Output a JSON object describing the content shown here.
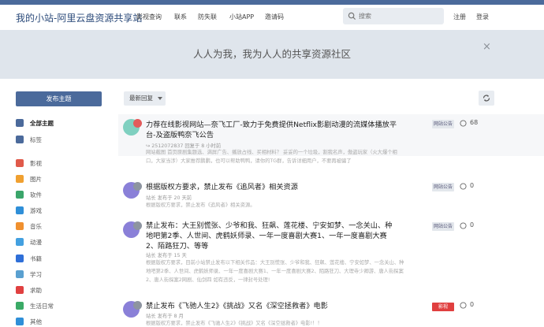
{
  "header": {
    "site_title": "我的小站-阿里云盘资源共享站",
    "nav": [
      {
        "label": "影视查询"
      },
      {
        "label": "联系"
      },
      {
        "label": "防失联"
      },
      {
        "label": "小站APP"
      },
      {
        "label": "邀请码"
      }
    ],
    "search_placeholder": "搜索",
    "register": "注册",
    "login": "登录"
  },
  "banner": {
    "text": "人人为我，我为人人的共享资源社区",
    "close": "×"
  },
  "sidebar": {
    "new_topic": "发布主题",
    "items": [
      {
        "label": "全部主题",
        "color": "#4b6a9b",
        "icon": "chat-icon"
      },
      {
        "label": "标签",
        "color": "#4b6a9b",
        "icon": "grid-icon"
      },
      {
        "label": "影视",
        "color": "#e05a4a",
        "icon": "film-icon"
      },
      {
        "label": "图片",
        "color": "#f0a030",
        "icon": "image-icon"
      },
      {
        "label": "软件",
        "color": "#3aa56a",
        "icon": "software-icon"
      },
      {
        "label": "游戏",
        "color": "#2f8fd8",
        "icon": "game-icon"
      },
      {
        "label": "音乐",
        "color": "#f0902f",
        "icon": "music-icon"
      },
      {
        "label": "动漫",
        "color": "#43a0e0",
        "icon": "anime-icon"
      },
      {
        "label": "书籍",
        "color": "#2f6fd8",
        "icon": "book-icon"
      },
      {
        "label": "学习",
        "color": "#5aa0d0",
        "icon": "study-icon"
      },
      {
        "label": "求助",
        "color": "#e04040",
        "icon": "help-icon"
      },
      {
        "label": "生活日常",
        "color": "#3aaa66",
        "icon": "life-icon"
      },
      {
        "label": "其他",
        "color": "#2f8fd8",
        "icon": "other-icon"
      }
    ]
  },
  "toolbar": {
    "sort_label": "最新回复"
  },
  "topics": [
    {
      "title": "力荐在线影视网站—奈飞工厂-致力于免费提供Netflix影剧动漫的流媒体播放平台-及盗版鸭奈飞公告",
      "meta": "↪ 2512072837 回复于 8 小时前",
      "excerpt": "网站截图 首页原剧集题选、满屏广告、播放占线、买相材料？ 妥妥的一个垃圾，割我名声，傲盗玩家（火大爆个相口，大家当涉）大家推荐鹏鹏，也可以帮助鸭鸭，请你的TG群，告诉详细用户，不要再被骗了",
      "category": "网站公告",
      "replies": "68",
      "avatar_color": "#7fd0c0"
    },
    {
      "title": "根据版权方要求，禁止发布《追风者》相关资源",
      "meta": "站长 发布于 20 天前",
      "excerpt": "根据版权方要求，禁止发布《追风者》相关资源。",
      "category": "网站公告",
      "replies": "0",
      "avatar_color": "#8a80d8"
    },
    {
      "title": "禁止发布：大王别慌张、少爷和我、狂飙、莲花楼、宁安如梦、一念关山、种地吧第2季、人世间、虎鹤妖师录、一年一度喜剧大赛1、一年一度喜剧大赛2、陌路狂刀、等等",
      "meta": "站长 发布于 15 天",
      "excerpt": "根据版权方要求，目前小站禁止发布以下相关作品：大王别慌张、少爷和我、狂飙、莲花楼、宁安如梦、一念关山、种地吧第2季、人世间、虎鹤妖师录、一年一度喜剧大赛1、一年一度喜剧大赛2、陌路狂刀、大理寺少卿游、唐人街探案2、唐人街探案2网剧、仙剑四 如有违反，一律封号处理!",
      "category": "网站公告",
      "replies": "0",
      "avatar_color": "#8a80d8"
    },
    {
      "title": "禁止发布《飞驰人生2》《挑战》又名《深空拯救者》电影",
      "meta": "站长 发布于 8 月",
      "excerpt": "根据版权方要求，禁止发布《飞驰人生2》《挑战》又名《深空拯救者》电影!！！",
      "category": "影视",
      "replies": "0",
      "avatar_color": "#8a80d8"
    }
  ]
}
